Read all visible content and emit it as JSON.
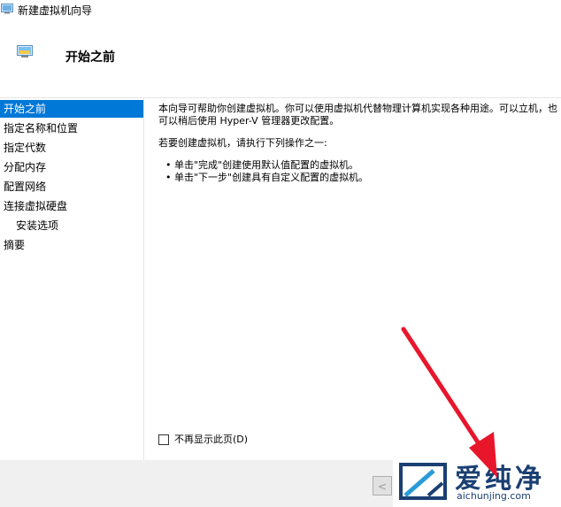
{
  "window": {
    "title": "新建虚拟机向导"
  },
  "header": {
    "title": "开始之前"
  },
  "sidebar": {
    "items": [
      {
        "label": "开始之前",
        "active": true
      },
      {
        "label": "指定名称和位置"
      },
      {
        "label": "指定代数"
      },
      {
        "label": "分配内存"
      },
      {
        "label": "配置网络"
      },
      {
        "label": "连接虚拟硬盘"
      },
      {
        "label": "安装选项",
        "sub": true
      },
      {
        "label": "摘要"
      }
    ]
  },
  "content": {
    "intro": "本向导可帮助你创建虚拟机。你可以使用虚拟机代替物理计算机实现各种用途。可以立机，也可以稍后使用 Hyper-V 管理器更改配置。",
    "prompt": "若要创建虚拟机，请执行下列操作之一:",
    "bullets": [
      "• 单击\"完成\"创建使用默认值配置的虚拟机。",
      "• 单击\"下一步\"创建具有自定义配置的虚拟机。"
    ],
    "checkbox_label": "不再显示此页(D)",
    "checkbox_checked": false
  },
  "footer": {
    "back_label": "<"
  },
  "watermark": {
    "text": "爱纯净",
    "url": "aichunjing.com"
  },
  "colors": {
    "accent": "#0078d7",
    "arrow": "#e8162b",
    "watermark": "#1a3f73"
  }
}
